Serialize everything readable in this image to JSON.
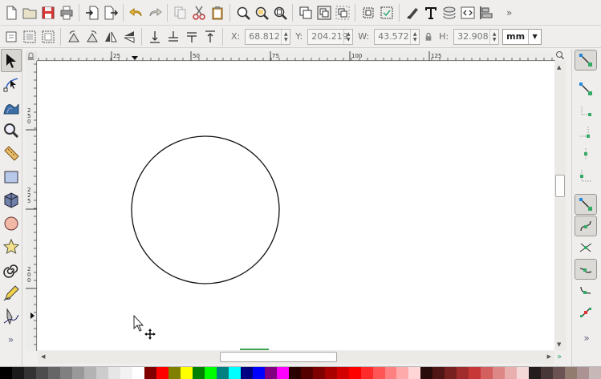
{
  "commands": {
    "file": [
      "new-document-icon",
      "open-folder-icon",
      "save-icon",
      "print-icon"
    ],
    "io": [
      "import-icon",
      "export-icon"
    ],
    "history": [
      "undo-icon",
      "redo-icon"
    ],
    "clipboard": [
      "copy-icon",
      "cut-icon",
      "paste-icon"
    ],
    "zoom": [
      "zoom-selection-icon",
      "zoom-drawing-icon",
      "zoom-page-icon"
    ],
    "objects": [
      "duplicate-icon",
      "group-icon",
      "ungroup-icon"
    ],
    "select": [
      "select-all-icon",
      "select-same-icon"
    ],
    "dialogs": [
      "fill-stroke-icon",
      "text-font-icon",
      "layers-icon",
      "xml-editor-icon",
      "align-distribute-icon"
    ],
    "overflow": "»"
  },
  "select_tool_controls": {
    "x": {
      "label": "X:",
      "value": "68.812"
    },
    "y": {
      "label": "Y:",
      "value": "204.219"
    },
    "w": {
      "label": "W:",
      "value": "43.572"
    },
    "h": {
      "label": "H:",
      "value": "32.908"
    },
    "unit": "mm"
  },
  "rulers": {
    "horizontal_labels": [
      "25",
      "50",
      "75",
      "100",
      "125"
    ],
    "vertical_labels": [
      [
        "2",
        "5",
        "0"
      ],
      [
        "2",
        "2",
        "5"
      ],
      [
        "2",
        "0",
        "0"
      ]
    ]
  },
  "tools": [
    "selector-arrow-icon",
    "node-editor-icon",
    "tweak-icon",
    "zoom-magnifier-icon",
    "measure-ruler-icon",
    "rectangle-icon",
    "3d-box-icon",
    "ellipse-icon",
    "star-polygon-icon",
    "spiral-icon",
    "pencil-icon",
    "pen-bezier-icon"
  ],
  "snap_controls": [
    "snap-enable-icon",
    "snap-bbox-icon",
    "snap-bbox-edge-icon",
    "snap-bbox-corner-icon",
    "snap-bbox-midpoint-icon",
    "snap-center-icon",
    "snap-nodes-icon",
    "snap-path-icon",
    "snap-intersection-icon",
    "snap-cusp-icon",
    "snap-smooth-icon",
    "snap-midpoint-icon"
  ],
  "colors": {
    "palette": [
      "#000000",
      "#1a1a1a",
      "#333333",
      "#4d4d4d",
      "#666666",
      "#808080",
      "#999999",
      "#b3b3b3",
      "#cccccc",
      "#e6e6e6",
      "#f2f2f2",
      "#ffffff",
      "#800000",
      "#ff0000",
      "#808000",
      "#ffff00",
      "#008000",
      "#00ff00",
      "#008080",
      "#00ffff",
      "#000080",
      "#0000ff",
      "#800080",
      "#ff00ff",
      "#2b0000",
      "#550000",
      "#800000",
      "#aa0000",
      "#d40000",
      "#ff0000",
      "#ff2a2a",
      "#ff5555",
      "#ff8080",
      "#ffaaaa",
      "#ffd5d5",
      "#280b0b",
      "#501616",
      "#782121",
      "#a02c2c",
      "#c83737",
      "#d35f5f",
      "#de8787",
      "#e9afaf",
      "#f4d7d7",
      "#241c1c",
      "#483737",
      "#6c5353",
      "#917c6f",
      "#ac9393",
      "#c8b7b7"
    ]
  }
}
